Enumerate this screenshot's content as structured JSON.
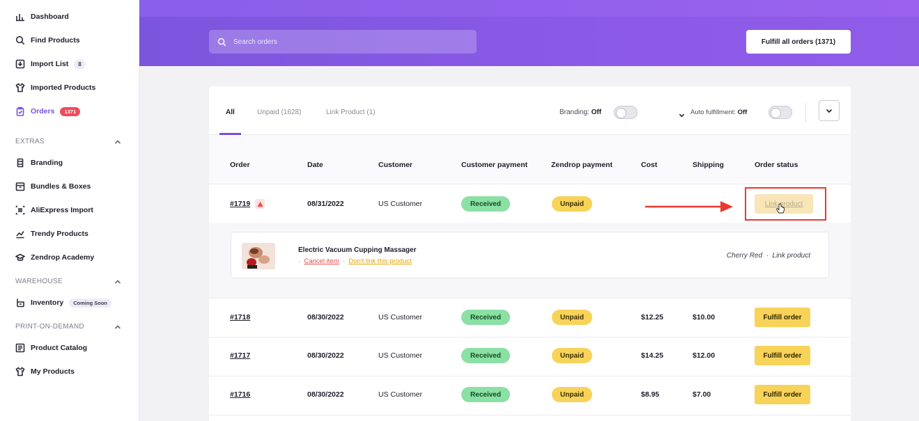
{
  "sidebar": {
    "items": [
      {
        "label": "Dashboard",
        "icon": "bar-chart-icon"
      },
      {
        "label": "Find Products",
        "icon": "search-icon"
      },
      {
        "label": "Import List",
        "icon": "import-icon",
        "badge": "8"
      },
      {
        "label": "Imported Products",
        "icon": "shirt-icon"
      },
      {
        "label": "Orders",
        "icon": "clipboard-icon",
        "badge": "1371",
        "active": true
      }
    ],
    "sections": [
      {
        "title": "EXTRAS",
        "items": [
          {
            "label": "Branding",
            "icon": "branding-icon"
          },
          {
            "label": "Bundles & Boxes",
            "icon": "box-icon"
          },
          {
            "label": "AliExpress Import",
            "icon": "aliexpress-icon"
          },
          {
            "label": "Trendy Products",
            "icon": "trend-icon"
          },
          {
            "label": "Zendrop Academy",
            "icon": "graduation-cap-icon"
          }
        ]
      },
      {
        "title": "WAREHOUSE",
        "items": [
          {
            "label": "Inventory",
            "icon": "warehouse-icon",
            "badge": "Coming Soon"
          }
        ]
      },
      {
        "title": "PRINT-ON-DEMAND",
        "items": [
          {
            "label": "Product Catalog",
            "icon": "catalog-icon"
          },
          {
            "label": "My Products",
            "icon": "shirt-icon"
          }
        ]
      }
    ]
  },
  "header": {
    "search_placeholder": "Search orders",
    "fulfill_all_label": "Fulfill all orders (1371)"
  },
  "tabs": [
    {
      "label": "All",
      "active": true
    },
    {
      "label": "Unpaid (1628)"
    },
    {
      "label": "Link Product (1)"
    }
  ],
  "toggles": {
    "branding_label": "Branding:",
    "branding_value": "Off",
    "auto_label": "Auto fulfillment:",
    "auto_value": "Off"
  },
  "columns": [
    "Order",
    "Date",
    "Customer",
    "Customer payment",
    "Zendrop payment",
    "Cost",
    "Shipping",
    "Order status"
  ],
  "expanded_order": {
    "order": "#1719",
    "date": "08/31/2022",
    "customer": "US Customer",
    "customer_payment": "Received",
    "zendrop_payment": "Unpaid",
    "status_button": "Link product",
    "product": {
      "name": "Electric Vacuum Cupping Massager",
      "cancel": "Cancel item",
      "dont_link": "Don't link this product",
      "variant": "Cherry Red",
      "variant_status": "Link product"
    }
  },
  "orders": [
    {
      "order": "#1718",
      "date": "08/30/2022",
      "customer": "US Customer",
      "customer_payment": "Received",
      "zendrop_payment": "Unpaid",
      "cost": "$12.25",
      "shipping": "$10.00",
      "action": "Fulfill order"
    },
    {
      "order": "#1717",
      "date": "08/30/2022",
      "customer": "US Customer",
      "customer_payment": "Received",
      "zendrop_payment": "Unpaid",
      "cost": "$14.25",
      "shipping": "$12.00",
      "action": "Fulfill order"
    },
    {
      "order": "#1716",
      "date": "08/30/2022",
      "customer": "US Customer",
      "customer_payment": "Received",
      "zendrop_payment": "Unpaid",
      "cost": "$8.95",
      "shipping": "$7.00",
      "action": "Fulfill order"
    }
  ],
  "colors": {
    "accent": "#7b4fe0",
    "received": "#8be0a4",
    "unpaid": "#f8d35a",
    "badge_red": "#ef4b5b",
    "highlight": "#e8392f"
  }
}
